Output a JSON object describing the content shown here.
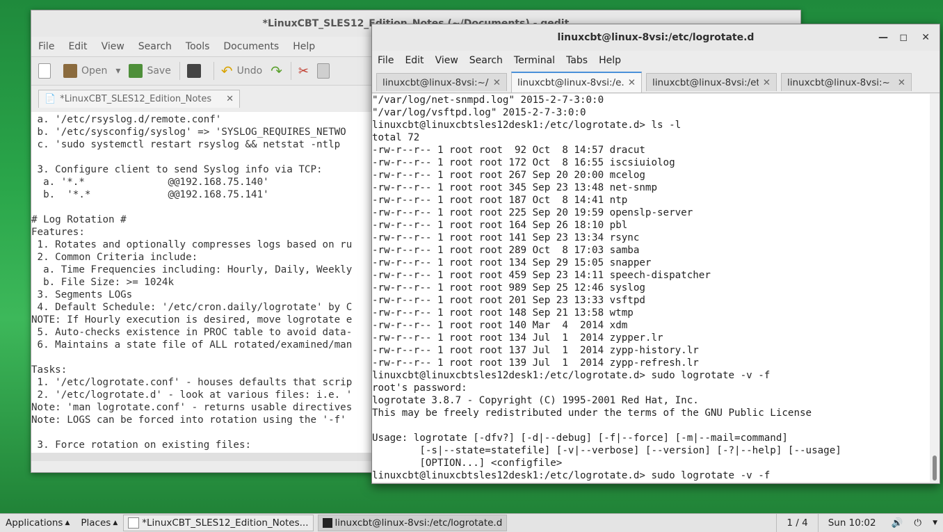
{
  "gedit": {
    "title": "*LinuxCBT_SLES12_Edition_Notes (~/Documents) - gedit",
    "menu": [
      "File",
      "Edit",
      "View",
      "Search",
      "Tools",
      "Documents",
      "Help"
    ],
    "toolbar": {
      "open": "Open",
      "save": "Save",
      "undo": "Undo"
    },
    "tab_label": "*LinuxCBT_SLES12_Edition_Notes",
    "lines": [
      " a. '/etc/rsyslog.d/remote.conf'",
      " b. '/etc/sysconfig/syslog' => 'SYSLOG_REQUIRES_NETWO",
      " c. 'sudo systemctl restart rsyslog && netstat -ntlp",
      "",
      " 3. Configure client to send Syslog info via TCP:",
      "  a. '*.*              @@192.168.75.140'",
      "  b.  '*.*             @@192.168.75.141'",
      "",
      "# Log Rotation #",
      "Features:",
      " 1. Rotates and optionally compresses logs based on ru",
      " 2. Common Criteria include:",
      "  a. Time Frequencies including: Hourly, Daily, Weekly",
      "  b. File Size: >= 1024k",
      " 3. Segments LOGs",
      " 4. Default Schedule: '/etc/cron.daily/logrotate' by C",
      "NOTE: If Hourly execution is desired, move logrotate e",
      " 5. Auto-checks existence in PROC table to avoid data-",
      " 6. Maintains a state file of ALL rotated/examined/man",
      "",
      "Tasks:",
      " 1. '/etc/logrotate.conf' - houses defaults that scrip",
      " 2. '/etc/logrotate.d' - look at various files: i.e. '",
      "Note: 'man logrotate.conf' - returns usable directives",
      "Note: LOGS can be forced into rotation using the '-f'",
      "",
      " 3. Force rotation on existing files:"
    ]
  },
  "terminal": {
    "title": "linuxcbt@linux-8vsi:/etc/logrotate.d",
    "menu": [
      "File",
      "Edit",
      "View",
      "Search",
      "Terminal",
      "Tabs",
      "Help"
    ],
    "tabs": [
      "linuxcbt@linux-8vsi:~/...",
      "linuxcbt@linux-8vsi:/e...",
      "linuxcbt@linux-8vsi:/etc",
      "linuxcbt@linux-8vsi:~"
    ],
    "lines": [
      "\"/var/log/net-snmpd.log\" 2015-2-7-3:0:0",
      "\"/var/log/vsftpd.log\" 2015-2-7-3:0:0",
      "linuxcbt@linuxcbtsles12desk1:/etc/logrotate.d> ls -l",
      "total 72",
      "-rw-r--r-- 1 root root  92 Oct  8 14:57 dracut",
      "-rw-r--r-- 1 root root 172 Oct  8 16:55 iscsiuiolog",
      "-rw-r--r-- 1 root root 267 Sep 20 20:00 mcelog",
      "-rw-r--r-- 1 root root 345 Sep 23 13:48 net-snmp",
      "-rw-r--r-- 1 root root 187 Oct  8 14:41 ntp",
      "-rw-r--r-- 1 root root 225 Sep 20 19:59 openslp-server",
      "-rw-r--r-- 1 root root 164 Sep 26 18:10 pbl",
      "-rw-r--r-- 1 root root 141 Sep 23 13:34 rsync",
      "-rw-r--r-- 1 root root 289 Oct  8 17:03 samba",
      "-rw-r--r-- 1 root root 134 Sep 29 15:05 snapper",
      "-rw-r--r-- 1 root root 459 Sep 23 14:11 speech-dispatcher",
      "-rw-r--r-- 1 root root 989 Sep 25 12:46 syslog",
      "-rw-r--r-- 1 root root 201 Sep 23 13:33 vsftpd",
      "-rw-r--r-- 1 root root 148 Sep 21 13:58 wtmp",
      "-rw-r--r-- 1 root root 140 Mar  4  2014 xdm",
      "-rw-r--r-- 1 root root 134 Jul  1  2014 zypper.lr",
      "-rw-r--r-- 1 root root 137 Jul  1  2014 zypp-history.lr",
      "-rw-r--r-- 1 root root 139 Jul  1  2014 zypp-refresh.lr",
      "linuxcbt@linuxcbtsles12desk1:/etc/logrotate.d> sudo logrotate -v -f",
      "root's password:",
      "logrotate 3.8.7 - Copyright (C) 1995-2001 Red Hat, Inc.",
      "This may be freely redistributed under the terms of the GNU Public License",
      "",
      "Usage: logrotate [-dfv?] [-d|--debug] [-f|--force] [-m|--mail=command]",
      "        [-s|--state=statefile] [-v|--verbose] [--version] [-?|--help] [--usage]",
      "        [OPTION...] <configfile>",
      "linuxcbt@linuxcbtsles12desk1:/etc/logrotate.d> sudo logrotate -v -f"
    ]
  },
  "panel": {
    "applications": "Applications",
    "places": "Places",
    "task1": "*LinuxCBT_SLES12_Edition_Notes...",
    "task2": "linuxcbt@linux-8vsi:/etc/logrotate.d",
    "workspace": "1 / 4",
    "clock": "Sun 10:02"
  }
}
